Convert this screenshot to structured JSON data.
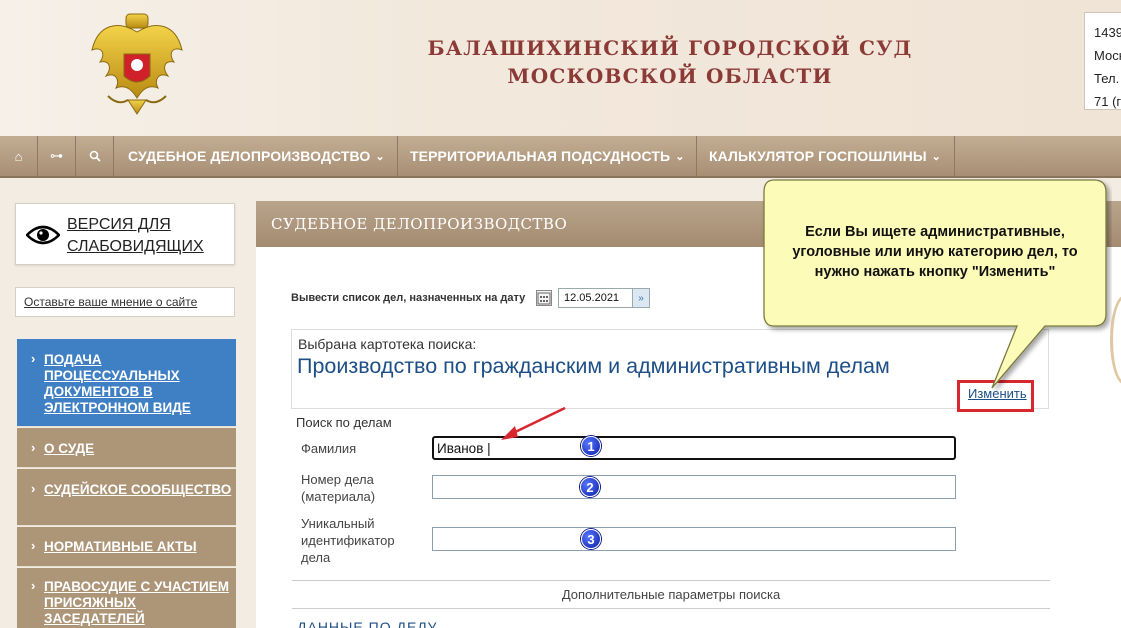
{
  "header": {
    "title_line1": "БАЛАШИХИНСКИЙ ГОРОДСКОЙ СУД",
    "title_line2": "МОСКОВСКОЙ ОБЛАСТИ",
    "contact_lines": [
      "1439",
      "Моск",
      "Тел.",
      "71 (г"
    ]
  },
  "nav": {
    "icons": [
      "home-icon",
      "sitemap-icon",
      "search-icon"
    ],
    "items": [
      {
        "label": "СУДЕБНОЕ ДЕЛОПРОИЗВОДСТВО",
        "chevron": "⌄"
      },
      {
        "label": "ТЕРРИТОРИАЛЬНАЯ ПОДСУДНОСТЬ",
        "chevron": "⌄"
      },
      {
        "label": "КАЛЬКУЛЯТОР ГОСПОШЛИНЫ",
        "chevron": "⌄"
      }
    ]
  },
  "sidebar": {
    "vision_label": "ВЕРСИЯ ДЛЯ СЛАБОВИДЯЩИХ",
    "opinion_link": "Оставьте ваше мнение о сайте",
    "menu": [
      {
        "label": "ПОДАЧА ПРОЦЕССУАЛЬНЫХ ДОКУМЕНТОВ В ЭЛЕКТРОННОМ ВИДЕ",
        "active": true
      },
      {
        "label": "О СУДЕ",
        "active": false
      },
      {
        "label": "СУДЕЙСКОЕ СООБЩЕСТВО",
        "active": false
      },
      {
        "label": "НОРМАТИВНЫЕ АКТЫ",
        "active": false
      },
      {
        "label": "ПРАВОСУДИЕ С УЧАСТИЕМ ПРИСЯЖНЫХ ЗАСЕДАТЕЛЕЙ",
        "active": false
      }
    ]
  },
  "main": {
    "title": "СУДЕБНОЕ ДЕЛОПРОИЗВОДСТВО",
    "date_label": "Вывести список дел, назначенных на дату",
    "date_value": "12.05.2021",
    "card_caption": "Выбрана картотека поиска:",
    "card_name": "Производство по гражданским и административным делам",
    "change_link": "Изменить",
    "search_heading": "Поиск по делам",
    "fields": {
      "surname_label": "Фамилия",
      "surname_value": "Иванов |",
      "case_number_label_1": "Номер дела",
      "case_number_label_2": "(материала)",
      "uid_label_1": "Уникальный",
      "uid_label_2": "идентификатор",
      "uid_label_3": "дела"
    },
    "badges": [
      "1",
      "2",
      "3"
    ],
    "extra_params": "Дополнительные параметры поиска",
    "case_data_heading": "ДАННЫЕ ПО ДЕЛУ"
  },
  "callout": {
    "text": "Если Вы ищете административные, уголовные или иную категорию дел, то нужно нажать кнопку \"Изменить\""
  },
  "colors": {
    "accent_blue": "#3f7fc3",
    "menu_brown": "#ad9578",
    "title_red": "#8c3a35",
    "highlight_red": "#d7282f",
    "callout_yellow": "#fdfbb8"
  }
}
